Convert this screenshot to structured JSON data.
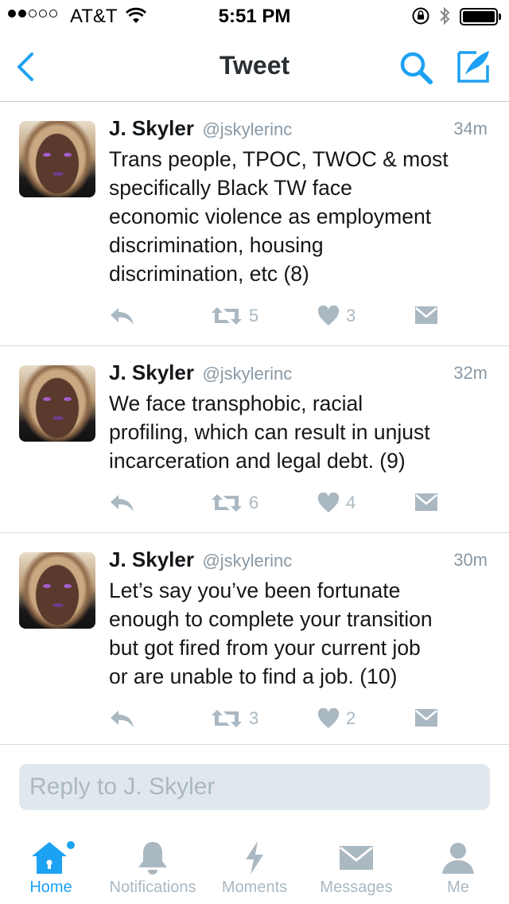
{
  "status_bar": {
    "carrier": "AT&T",
    "time": "5:51 PM",
    "signal_bars_filled": 2,
    "signal_bars_total": 5
  },
  "nav": {
    "title": "Tweet",
    "back_icon": "chevron-left-icon",
    "search_icon": "search-icon",
    "compose_icon": "compose-icon"
  },
  "colors": {
    "accent": "#1da1f2",
    "muted": "#aab8c2",
    "text": "#14171a"
  },
  "tweets": [
    {
      "name": "J. Skyler",
      "handle": "@jskylerinc",
      "time": "34m",
      "text": [
        "Trans people, TPOC, TWOC & most",
        "specifically Black TW face",
        "economic violence as employment",
        "discrimination, housing",
        "discrimination, etc (8)"
      ],
      "retweets": "5",
      "likes": "3"
    },
    {
      "name": "J. Skyler",
      "handle": "@jskylerinc",
      "time": "32m",
      "text": [
        "We face transphobic, racial",
        "profiling, which can result in unjust",
        "incarceration and legal debt. (9)"
      ],
      "retweets": "6",
      "likes": "4"
    },
    {
      "name": "J. Skyler",
      "handle": "@jskylerinc",
      "time": "30m",
      "text": [
        "Let’s say you’ve been fortunate",
        "enough to complete your transition",
        "but got fired from your current job",
        "or are unable to find a job. (10)"
      ],
      "retweets": "3",
      "likes": "2"
    }
  ],
  "reply": {
    "placeholder": "Reply to J. Skyler"
  },
  "tabs": [
    {
      "label": "Home",
      "icon": "home-icon",
      "active": true,
      "has_notification_dot": true
    },
    {
      "label": "Notifications",
      "icon": "bell-icon",
      "active": false
    },
    {
      "label": "Moments",
      "icon": "lightning-icon",
      "active": false
    },
    {
      "label": "Messages",
      "icon": "envelope-icon",
      "active": false
    },
    {
      "label": "Me",
      "icon": "person-icon",
      "active": false
    }
  ]
}
